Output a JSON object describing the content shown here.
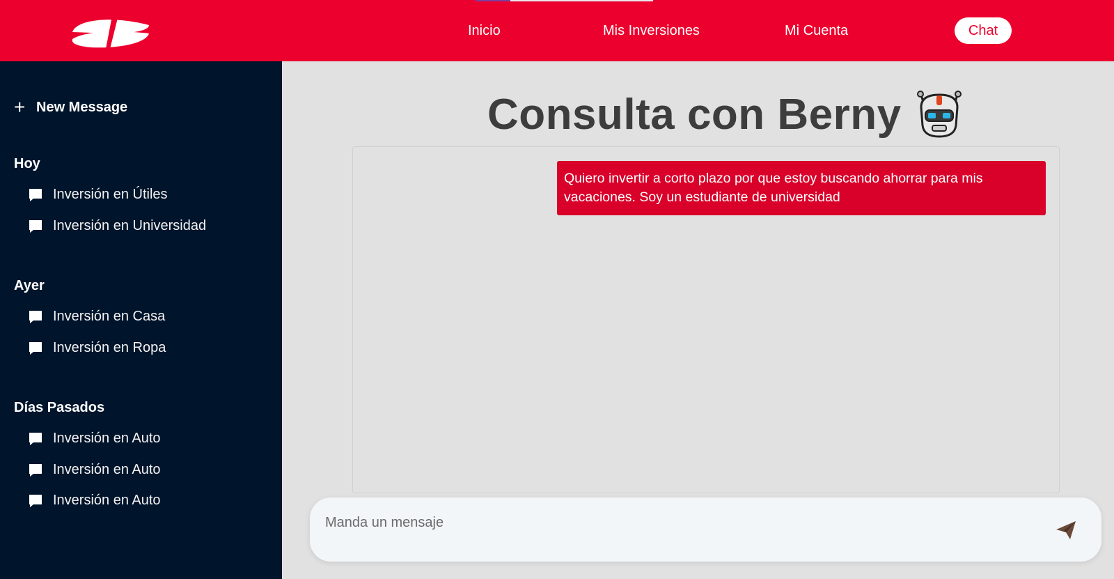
{
  "header": {
    "nav": [
      {
        "label": "Inicio"
      },
      {
        "label": "Mis Inversiones"
      },
      {
        "label": "Mi Cuenta"
      }
    ],
    "chat_label": "Chat",
    "brand_color": "#ec002d"
  },
  "sidebar": {
    "new_message_label": "New Message",
    "groups": [
      {
        "title": "Hoy",
        "items": [
          {
            "label": "Inversión en Útiles"
          },
          {
            "label": "Inversión en Universidad"
          }
        ]
      },
      {
        "title": "Ayer",
        "items": [
          {
            "label": "Inversión en Casa"
          },
          {
            "label": "Inversión en Ropa"
          }
        ]
      },
      {
        "title": "Días Pasados",
        "items": [
          {
            "label": "Inversión en Auto"
          },
          {
            "label": "Inversión en Auto"
          },
          {
            "label": "Inversión en Auto"
          }
        ]
      }
    ],
    "background": "#00142b"
  },
  "main": {
    "title": "Consulta con Berny",
    "messages": [
      {
        "role": "user",
        "text": "Quiero invertir a corto plazo por que estoy buscando ahorrar para mis vacaciones. Soy un estudiante de universidad"
      }
    ],
    "input_placeholder": "Manda un mensaje"
  },
  "icons": {
    "logo": "santander-flame-logo",
    "new": "plus-icon",
    "chat": "chat-bubble-icon",
    "robot": "robot-icon",
    "send": "paper-plane-icon"
  }
}
